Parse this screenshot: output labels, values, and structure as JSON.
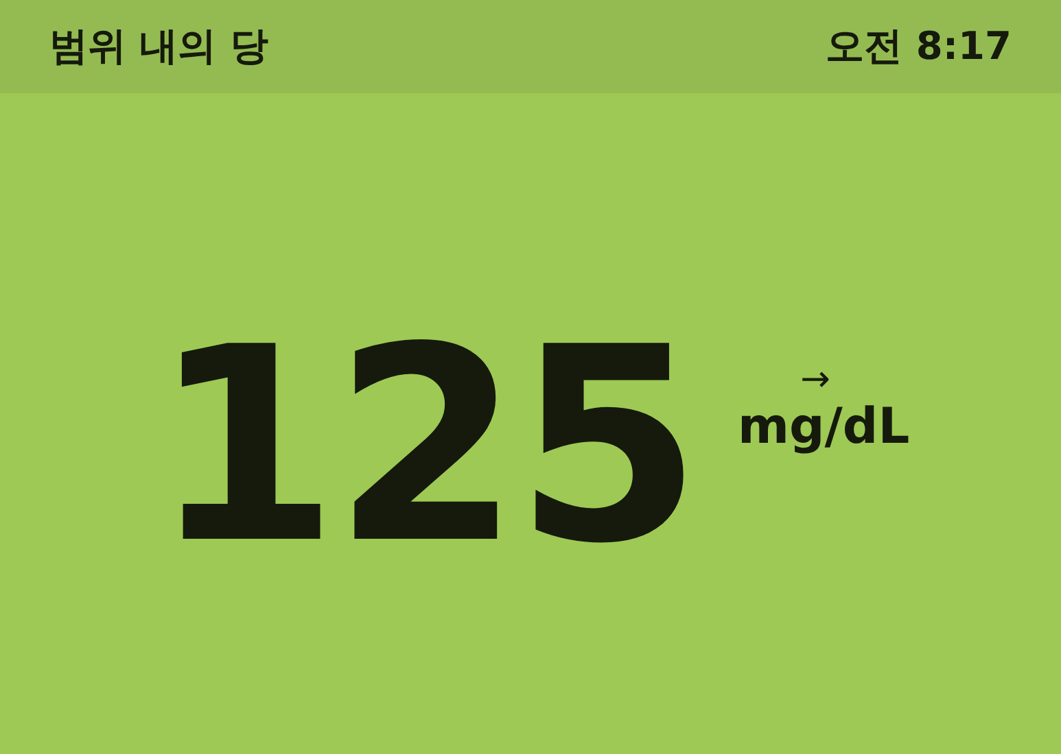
{
  "header": {
    "title": "범위 내의 당",
    "time": "오전 8:17"
  },
  "reading": {
    "value": "125",
    "trend_arrow": "→",
    "unit": "mg/dL"
  }
}
